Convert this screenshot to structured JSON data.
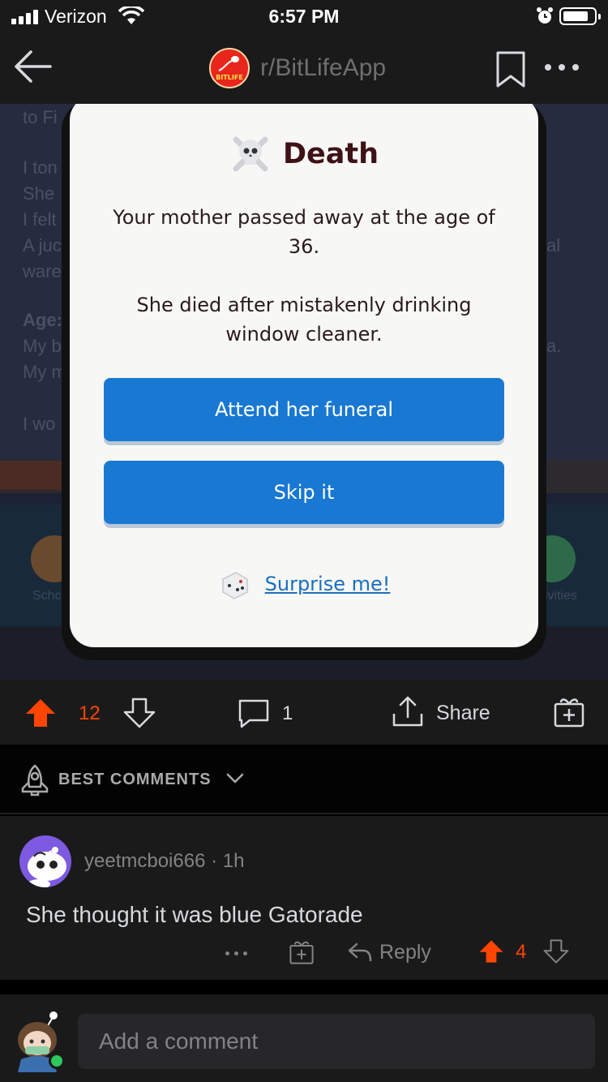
{
  "status_bar": {
    "carrier": "Verizon",
    "time": "6:57 PM"
  },
  "header": {
    "subreddit": "r/BitLifeApp",
    "logo_text": "BITLIFE"
  },
  "post_image": {
    "background_fragments": [
      "to Fi",
      "I ton",
      "She",
      "I felt",
      "A juc",
      "ware",
      "Age:",
      "My b",
      "My m",
      "I wo",
      "Schc",
      "lvities",
      "al",
      "a."
    ],
    "modal": {
      "title": "Death",
      "message": "Your mother passed away at the age of 36.",
      "detail": "She died after mistakenly drinking window cleaner.",
      "primary_button": "Attend her funeral",
      "secondary_button": "Skip it",
      "surprise_link": "Surprise me!"
    }
  },
  "action_bar": {
    "score": "12",
    "comments": "1",
    "share_label": "Share"
  },
  "comments_section": {
    "sort_label": "BEST COMMENTS"
  },
  "comment": {
    "author_line": "yeetmcboi666 · 1h",
    "body": "She thought it was blue Gatorade",
    "reply_label": "Reply",
    "score": "4"
  },
  "composer": {
    "placeholder": "Add a comment"
  },
  "colors": {
    "upvote": "#ff4500",
    "modal_button": "#1878d2",
    "background": "#1a1a1b"
  }
}
